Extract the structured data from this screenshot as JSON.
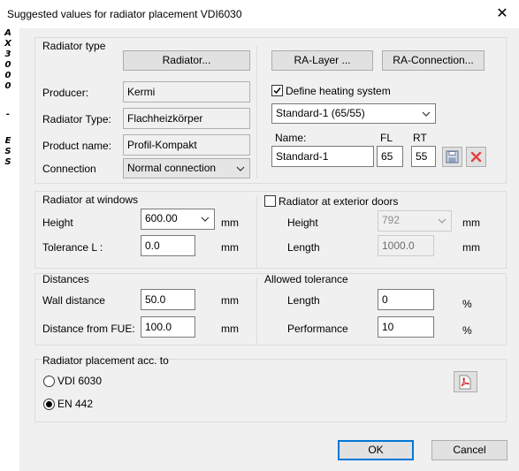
{
  "window": {
    "title": "Suggested values for radiator placement VDI6030",
    "close_glyph": "✕"
  },
  "sidebar": {
    "letters": [
      "A",
      "X",
      "3",
      "0",
      "0",
      "0",
      "-",
      "E",
      "S",
      "S"
    ]
  },
  "radiator_type": {
    "group_label": "Radiator type",
    "radiator_button": "Radiator...",
    "ra_layer_button": "RA-Layer ...",
    "ra_connection_button": "RA-Connection...",
    "producer_label": "Producer:",
    "producer_value": "Kermi",
    "radiator_type_label": "Radiator Type:",
    "radiator_type_value": "Flachheizkörper",
    "product_name_label": "Product name:",
    "product_name_value": "Profil-Kompakt",
    "connection_label": "Connection",
    "connection_value": "Normal connection",
    "define_heating_label": "Define heating system",
    "define_heating_checked": true,
    "heating_system_value": "Standard-1 (65/55)",
    "name_label": "Name:",
    "fl_label": "FL",
    "rt_label": "RT",
    "name_value": "Standard-1",
    "fl_value": "65",
    "rt_value": "55"
  },
  "windows": {
    "group_label": "Radiator at windows",
    "height_label": "Height",
    "height_value": "600.00",
    "height_unit": "mm",
    "tolerance_label": "Tolerance L :",
    "tolerance_value": "0.0",
    "tolerance_unit": "mm"
  },
  "doors": {
    "group_label": "Radiator at exterior doors",
    "checked": false,
    "height_label": "Height",
    "height_value": "792",
    "height_unit": "mm",
    "length_label": "Length",
    "length_value": "1000.0",
    "length_unit": "mm"
  },
  "distances": {
    "group_label": "Distances",
    "wall_label": "Wall distance",
    "wall_value": "50.0",
    "wall_unit": "mm",
    "fue_label": "Distance from FUE:",
    "fue_value": "100.0",
    "fue_unit": "mm"
  },
  "tolerance": {
    "group_label": "Allowed tolerance",
    "length_label": "Length",
    "length_value": "0",
    "length_unit": "%",
    "performance_label": "Performance",
    "performance_value": "10",
    "performance_unit": "%"
  },
  "placement": {
    "group_label": "Radiator placement acc. to",
    "vdi_label": "VDI 6030",
    "en_label": "EN 442",
    "selected": "EN 442"
  },
  "footer": {
    "ok_label": "OK",
    "cancel_label": "Cancel"
  }
}
